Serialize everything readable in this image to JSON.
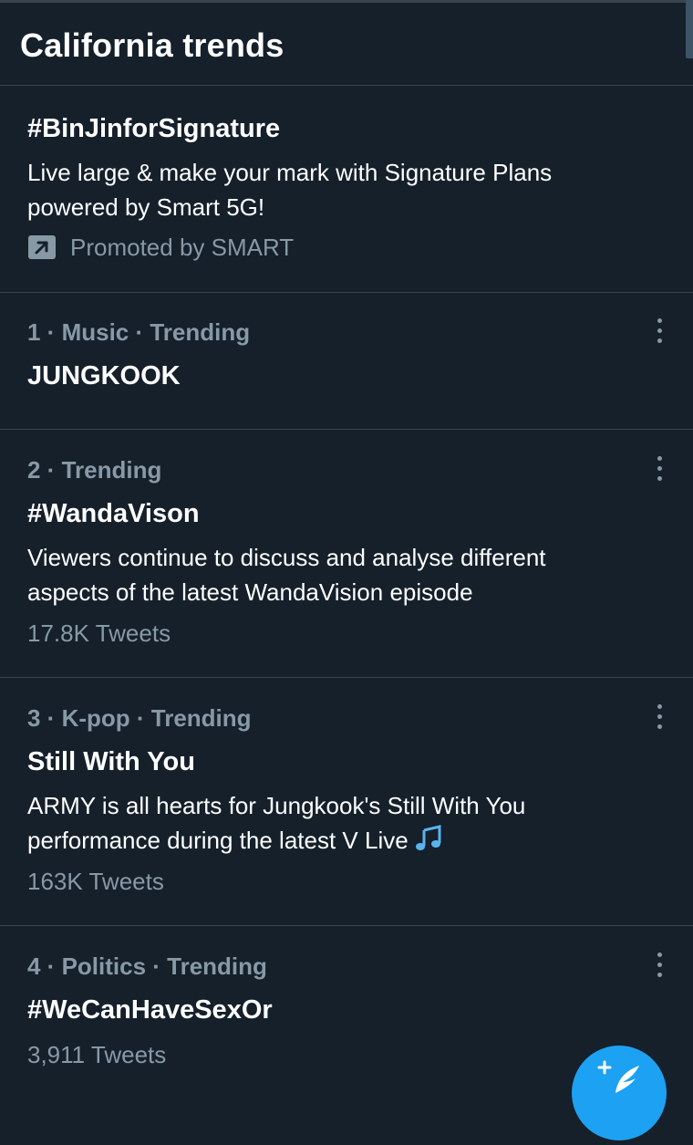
{
  "header": {
    "title": "California trends"
  },
  "promoted": {
    "title": "#BinJinforSignature",
    "description_line1": "Live large & make your mark with Signature Plans",
    "description_line2": "powered by Smart 5G!",
    "promoted_by": "Promoted by SMART"
  },
  "trends": [
    {
      "meta": "1 · Music · Trending",
      "title": "JUNGKOOK"
    },
    {
      "meta": "2 · Trending",
      "title": "#WandaVison",
      "description_line1": "Viewers continue to discuss and analyse different",
      "description_line2": "aspects of the latest WandaVision episode",
      "tweet_count": "17.8K Tweets"
    },
    {
      "meta": "3 · K-pop · Trending",
      "title": "Still With You",
      "description_line1": "ARMY is all hearts for Jungkook's Still With You",
      "description_line2": "performance during the latest V Live",
      "tweet_count": "163K Tweets"
    },
    {
      "meta": "4 · Politics · Trending",
      "title": "#WeCanHaveSexOr",
      "tweet_count": "3,911 Tweets"
    }
  ],
  "icons": {
    "more": "more-vertical-icon",
    "promoted": "promoted-arrow-icon",
    "music_note": "music-note-emoji",
    "compose": "compose-tweet-icon"
  },
  "colors": {
    "background": "#15202b",
    "divider": "#38444d",
    "secondary_text": "#8899a6",
    "accent": "#1da1f2"
  }
}
